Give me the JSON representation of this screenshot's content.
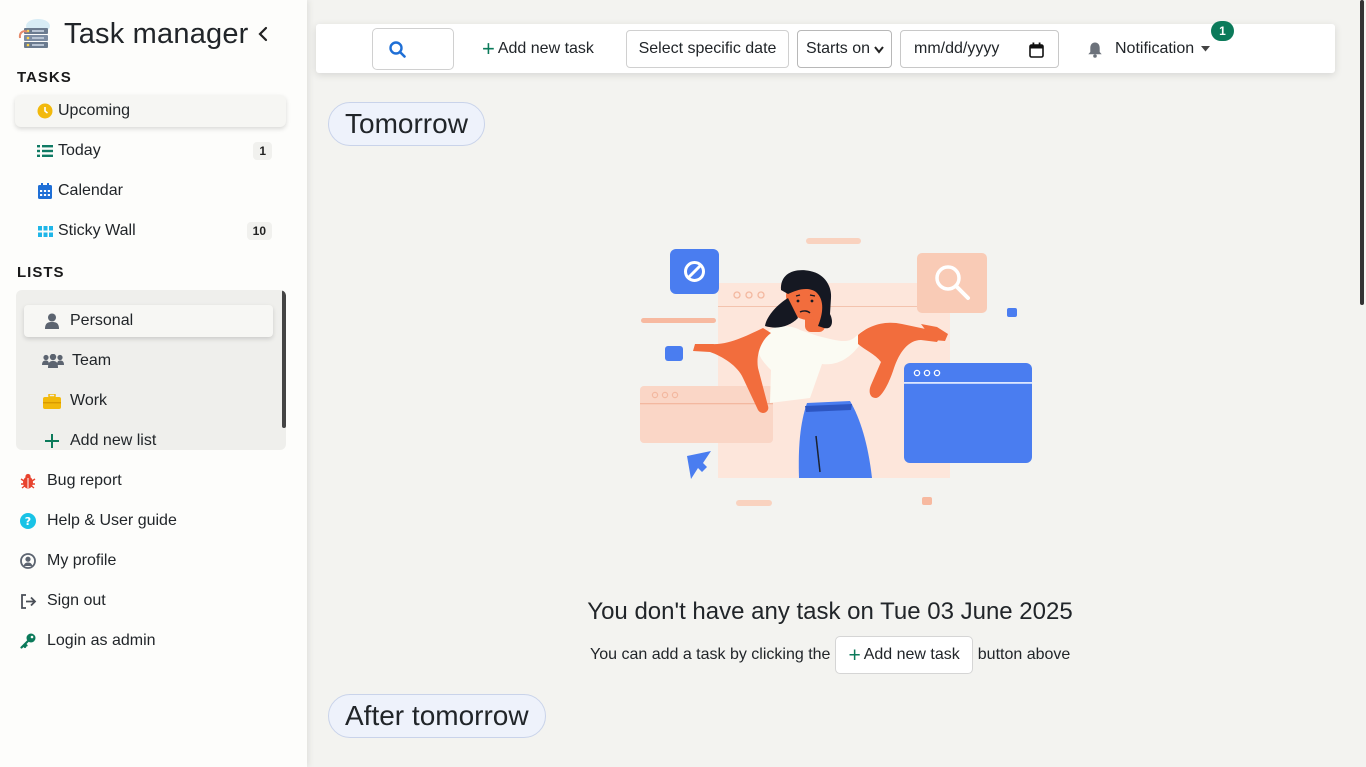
{
  "app": {
    "title": "Task manager"
  },
  "sidebar": {
    "tasks_heading": "TASKS",
    "tasks": [
      {
        "label": "Upcoming",
        "icon": "clock-icon",
        "count": ""
      },
      {
        "label": "Today",
        "icon": "list-icon",
        "count": "1"
      },
      {
        "label": "Calendar",
        "icon": "calendar-icon",
        "count": ""
      },
      {
        "label": "Sticky Wall",
        "icon": "grid-icon",
        "count": "10"
      }
    ],
    "lists_heading": "LISTS",
    "lists": [
      {
        "label": "Personal",
        "icon": "user-icon"
      },
      {
        "label": "Team",
        "icon": "users-icon"
      },
      {
        "label": "Work",
        "icon": "briefcase-icon"
      },
      {
        "label": "Add new list",
        "icon": "plus-icon"
      }
    ],
    "links": [
      {
        "label": "Bug report",
        "icon": "bug-icon"
      },
      {
        "label": "Help & User guide",
        "icon": "help-icon"
      },
      {
        "label": "My profile",
        "icon": "profile-icon"
      },
      {
        "label": "Sign out",
        "icon": "sign-out-icon"
      },
      {
        "label": "Login as admin",
        "icon": "key-icon"
      }
    ]
  },
  "toolbar": {
    "add_task_label": "Add new task",
    "select_date_label": "Select specific date",
    "starts_on_value": "Starts on",
    "date_placeholder": "mm/dd/yyyy",
    "notification_label": "Notification",
    "notification_count": "1"
  },
  "main": {
    "section_tomorrow": "Tomorrow",
    "empty_title": "You don't have any task on Tue 03 June 2025",
    "empty_sub_before": "You can add a task by clicking the",
    "empty_sub_button": "Add new task",
    "empty_sub_after": "button above",
    "section_after_tomorrow": "After tomorrow"
  },
  "colors": {
    "accent": "#0b7a5a",
    "illustration_blue": "#4a7df0",
    "illustration_peach": "#f9d2bf",
    "illustration_orange": "#f26d3d"
  }
}
